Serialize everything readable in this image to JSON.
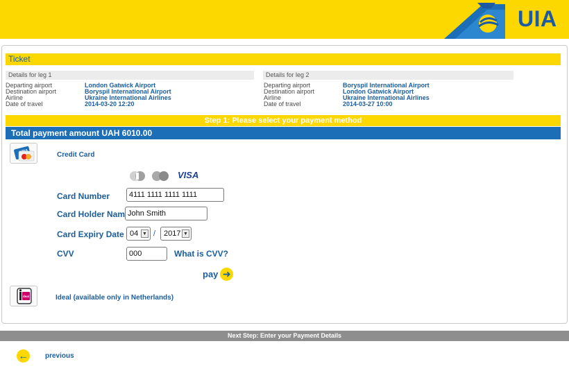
{
  "brand": {
    "name": "UIA",
    "color": "#fdd700",
    "accent": "#1c6fb7"
  },
  "ticket": {
    "title": "Ticket",
    "legs": [
      {
        "heading": "Details for leg 1",
        "rows": [
          {
            "label": "Departing airport",
            "value": "London Gatwick Airport"
          },
          {
            "label": "Destination airport",
            "value": "Boryspil International Airport"
          },
          {
            "label": "Airline",
            "value": "Ukraine International Airlines"
          },
          {
            "label": "Date of travel",
            "value": "2014-03-20 12:20"
          }
        ]
      },
      {
        "heading": "Details for leg 2",
        "rows": [
          {
            "label": "Departing airport",
            "value": "Boryspil International Airport"
          },
          {
            "label": "Destination airport",
            "value": "London Gatwick Airport"
          },
          {
            "label": "Airline",
            "value": "Ukraine International Airlines"
          },
          {
            "label": "Date of travel",
            "value": "2014-03-27 10:00"
          }
        ]
      }
    ]
  },
  "step": {
    "title": "Step 1: Please select your payment method"
  },
  "total": {
    "text": "Total payment amount UAH 6010.00"
  },
  "methods": {
    "credit_card": {
      "label": "Credit Card",
      "icon": "credit-card-icon"
    },
    "ideal": {
      "label": "Ideal (available only in Netherlands)",
      "icon": "ideal-icon"
    }
  },
  "card_brands": {
    "visa_label": "VISA"
  },
  "form": {
    "card_number": {
      "label": "Card Number",
      "value": "4111 1111 1111 1111"
    },
    "card_holder": {
      "label": "Card Holder Name",
      "value": "John Smith"
    },
    "expiry": {
      "label": "Card Expiry Date",
      "month": "04",
      "year": "2017",
      "separator": "/"
    },
    "cvv": {
      "label": "CVV",
      "value": "000",
      "help_link": "What is CVV?"
    }
  },
  "actions": {
    "pay_label": "pay",
    "previous_label": "previous"
  },
  "next_step": {
    "title": "Next Step: Enter your Payment Details"
  }
}
